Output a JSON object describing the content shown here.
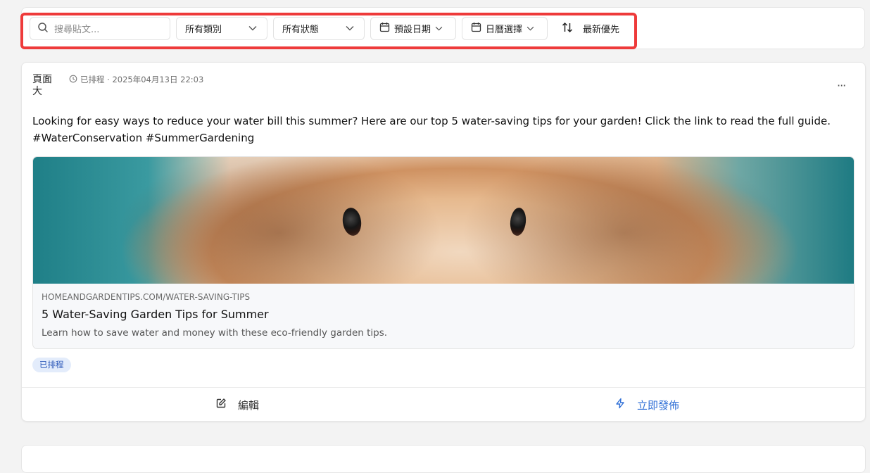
{
  "filters": {
    "search": {
      "placeholder": "搜尋貼文...",
      "icon": "search-icon"
    },
    "category": {
      "value": "所有類別"
    },
    "status": {
      "value": "所有狀態"
    },
    "date_preset": {
      "label": "預設日期"
    },
    "calendar_pick": {
      "label": "日曆選擇"
    },
    "sort": {
      "label": "最新優先"
    }
  },
  "post": {
    "avatar_alt": "頁面大",
    "meta": "已排程 · 2025年04月13日 22:03",
    "more": "···",
    "text_line1": "Looking for easy ways to reduce your water bill this summer? Here are our top 5 water-saving tips for your garden! Click the link to read the full guide.",
    "text_line2": "#WaterConservation #SummerGardening",
    "link": {
      "domain": "HOMEANDGARDENTIPS.COM/WATER-SAVING-TIPS",
      "title": "5 Water-Saving Garden Tips for Summer",
      "description": "Learn how to save water and money with these eco-friendly garden tips."
    },
    "badge": "已排程",
    "actions": {
      "edit": "編輯",
      "publish": "立即發佈"
    }
  },
  "colors": {
    "highlight": "#ee3a3a",
    "accent": "#2f6fd6",
    "badge_bg": "#e3ecfb"
  }
}
